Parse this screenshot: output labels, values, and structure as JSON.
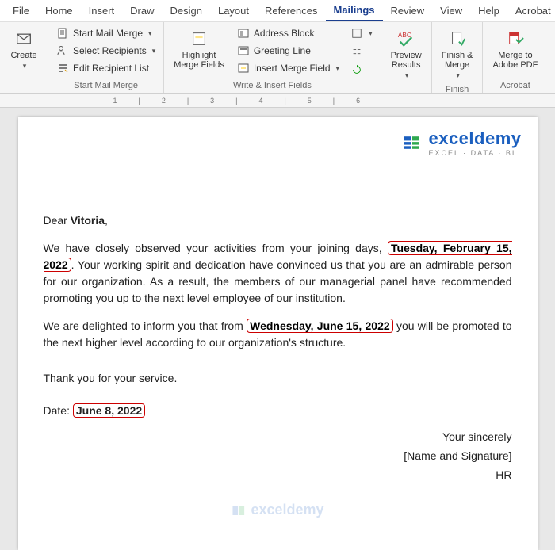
{
  "tabs": {
    "file": "File",
    "home": "Home",
    "insert": "Insert",
    "draw": "Draw",
    "design": "Design",
    "layout": "Layout",
    "references": "References",
    "mailings": "Mailings",
    "review": "Review",
    "view": "View",
    "help": "Help",
    "acrobat": "Acrobat"
  },
  "ribbon": {
    "create": "Create",
    "startMailMerge": "Start Mail Merge",
    "selectRecipients": "Select Recipients",
    "editRecipientList": "Edit Recipient List",
    "groupStartMailMerge": "Start Mail Merge",
    "highlightMergeFields": "Highlight\nMerge Fields",
    "addressBlock": "Address Block",
    "greetingLine": "Greeting Line",
    "insertMergeField": "Insert Merge Field",
    "groupWriteInsert": "Write & Insert Fields",
    "previewResults": "Preview\nResults",
    "finishMerge": "Finish &\nMerge",
    "groupFinish": "Finish",
    "mergePdf": "Merge to\nAdobe PDF",
    "groupAcrobat": "Acrobat"
  },
  "ruler": "· · · 1 · · · | · · · 2 · · · | · · · 3 · · · | · · · 4 · · · | · · · 5 · · · | · · · 6 · · ·",
  "logo": {
    "name": "exceldemy",
    "sub": "EXCEL · DATA · BI"
  },
  "letter": {
    "dear": "Dear ",
    "name": "Vitoria",
    "comma": ",",
    "p1a": "We have closely observed your activities from your joining days, ",
    "date1": "Tuesday, February 15, 2022",
    "p1b": ". Your working spirit and dedication have convinced us that you are an admirable person for our organization. As a result, the members of our managerial panel have recommended promoting you up to the next level employee of our institution.",
    "p2a": "We are delighted to inform you that from ",
    "date2": "Wednesday, June 15, 2022",
    "p2b": " you will be promoted to the next higher level according to our organization's structure.",
    "thanks": "Thank you for your service.",
    "dateLabel": "Date: ",
    "date3": "June 8, 2022",
    "sincerely": "Your sincerely",
    "sig": "[Name and Signature]",
    "hr": "HR"
  }
}
